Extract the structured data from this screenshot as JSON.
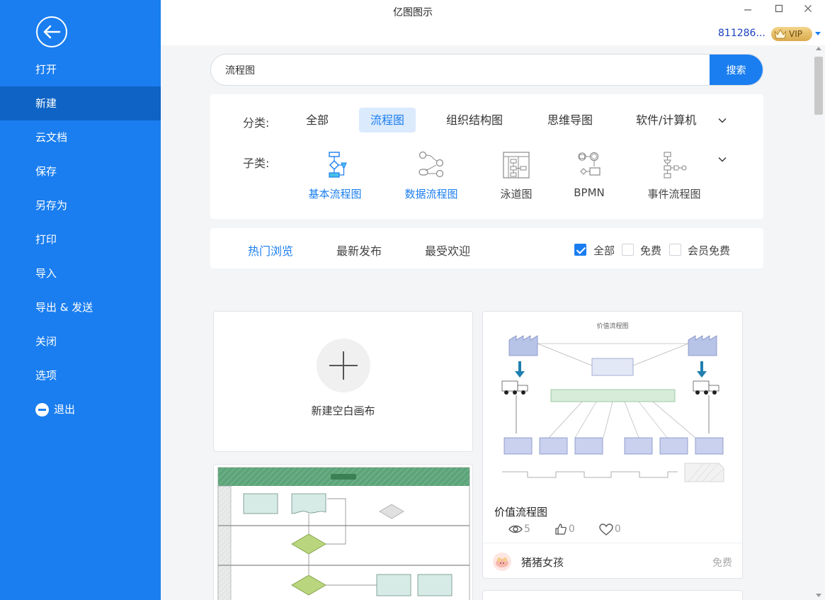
{
  "app": {
    "title": "亿图图示",
    "user_id": "811286...",
    "vip_label": "VIP"
  },
  "sidebar": {
    "items": [
      {
        "label": "打开"
      },
      {
        "label": "新建",
        "active": true
      },
      {
        "label": "云文档"
      },
      {
        "label": "保存"
      },
      {
        "label": "另存为"
      },
      {
        "label": "打印"
      },
      {
        "label": "导入"
      },
      {
        "label": "导出 & 发送"
      },
      {
        "label": "关闭"
      },
      {
        "label": "选项"
      },
      {
        "label": "退出",
        "icon": "exit-icon"
      }
    ]
  },
  "search": {
    "value": "流程图",
    "button_label": "搜索"
  },
  "categories": {
    "label": "分类:",
    "tabs": [
      "全部",
      "流程图",
      "组织结构图",
      "思维导图",
      "软件/计算机"
    ],
    "active": "流程图"
  },
  "subcategories": {
    "label": "子类:",
    "items": [
      "基本流程图",
      "数据流程图",
      "泳道图",
      "BPMN",
      "事件流程图"
    ]
  },
  "sort": {
    "tabs": [
      "热门浏览",
      "最新发布",
      "最受欢迎"
    ],
    "active": "热门浏览",
    "filters": [
      {
        "label": "全部",
        "checked": true
      },
      {
        "label": "免费",
        "checked": false
      },
      {
        "label": "会员免费",
        "checked": false
      }
    ]
  },
  "new_canvas": {
    "label": "新建空白画布"
  },
  "template": {
    "preview_title": "价值流程图",
    "title": "价值流程图",
    "views": "5",
    "likes": "0",
    "favorites": "0",
    "author": "猪猪女孩",
    "price": "免费"
  },
  "colors": {
    "primary": "#1a7ef0",
    "sidebar_active": "#0e63c4",
    "vip_gold": "#e3b95c"
  }
}
